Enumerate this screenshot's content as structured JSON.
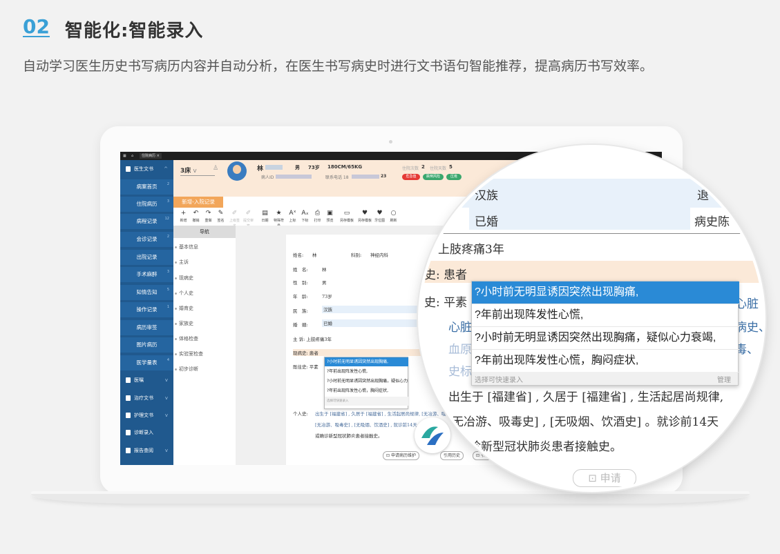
{
  "header": {
    "number": "02",
    "title": "智能化:智能录入",
    "description": "自动学习医生历史书写病历内容并自动分析，在医生书写病史时进行文书语句智能推荐，提高病历书写效率。"
  },
  "app": {
    "tab_label": "住院病历",
    "sidebar": {
      "section_doc": "医生文书",
      "items": [
        {
          "label": "病案首页",
          "count": "2"
        },
        {
          "label": "住院病历",
          "count": "3"
        },
        {
          "label": "病程记录",
          "count": "12"
        },
        {
          "label": "会诊记录",
          "count": "2"
        },
        {
          "label": "出院记录",
          "count": ""
        },
        {
          "label": "手术麻醉",
          "count": "3"
        },
        {
          "label": "知情告知",
          "count": "5"
        },
        {
          "label": "操作记录",
          "count": "1"
        },
        {
          "label": "病历审签",
          "count": ""
        },
        {
          "label": "图片病历",
          "count": ""
        },
        {
          "label": "医学量表",
          "count": "4"
        }
      ],
      "sections": [
        "医嘱",
        "治疗文书",
        "护理文书",
        "诊断录入",
        "报告查阅"
      ]
    },
    "patient": {
      "bed": "3床",
      "name": "林",
      "gender": "男",
      "age": "73岁",
      "height_weight": "180CM/65KG",
      "id_label": "病人ID",
      "phone_label": "联系电话 18",
      "phone_tail": "23",
      "admit_times": "住院次数",
      "admit_times_val": "2",
      "admit_days": "住院天数",
      "admit_days_val": "5",
      "badges": [
        "危急值",
        "跌倒风险",
        "压疮"
      ]
    },
    "record_tab": "新增-入院记录",
    "toolbar": [
      "新增",
      "撤销",
      "重做",
      "签名",
      "上级签名",
      "提交审签",
      "日期",
      "特殊符号",
      "上标",
      "下标",
      "打印",
      "预览",
      "另存模板",
      "另存模板",
      "牙位图",
      "刷新"
    ],
    "nav": {
      "title": "导航",
      "items": [
        "基本信息",
        "主诉",
        "现病史",
        "个人史",
        "婚育史",
        "家族史",
        "体格检查",
        "实验室检查",
        "初步诊断"
      ]
    },
    "doc": {
      "name_label": "姓名:",
      "name_val": "林",
      "dept_label": "科别:",
      "dept_val": "神经内科",
      "f_name": "姓　名:",
      "f_gender": "性　别:",
      "f_gender_val": "男",
      "f_age": "年　龄:",
      "f_age_val": "73岁",
      "f_ethnic": "民　族:",
      "f_ethnic_val": "汉族",
      "f_marital": "婚　姻:",
      "f_marital_val": "已婚",
      "complaint": "主 诉: 上肢疼痛3年",
      "present": "现病史: 患者",
      "past": "既往史: 平素",
      "personal_label": "个人史:",
      "personal_1": "出生于 [福建省] , 久居于 [福建省] , 生活起居尚规律, [无冶游、吸毒史] ,",
      "personal_2": "[无冶游、吸毒史] , [无吸烟、饮酒史] , 就诊前14天",
      "personal_3": "或确诊新型冠状肺炎患者接触史。"
    },
    "suggestions": [
      "?小时前无明显诱因突然出现胸痛,",
      "?年前出现阵发性心慌,",
      "?小时前无明显诱因突然出现胸痛，疑似心力衰竭,",
      "?年前出现阵发性心慌，胸闷症状,"
    ],
    "suggest_footer": "选择可快速录入",
    "suggest_manage": "管理",
    "bottom_buttons": [
      "申请病历维护",
      "引用历史",
      "书写"
    ]
  },
  "magnified": {
    "ethnic": "汉族",
    "extra_right": "退",
    "marital": "已婚",
    "history_label": "病史陈",
    "complaint": "上肢疼痛3年",
    "present_prefix": "史: 患者",
    "past_prefix": "史: 平素",
    "right_1": "心脏",
    "left_2": "心脏",
    "right_2": "病史、",
    "left_3": "血原",
    "right_3": "毒、",
    "left_4": "史标",
    "personal": "出生于 [福建省] , 久居于 [福建省] , 生活起居尚规律,",
    "personal_2": "无冶游、吸毒史] , [无吸烟、饮酒史] 。就诊前14天",
    "personal_3": "诊新型冠状肺炎患者接触史。",
    "bottom_btn": "申请"
  }
}
